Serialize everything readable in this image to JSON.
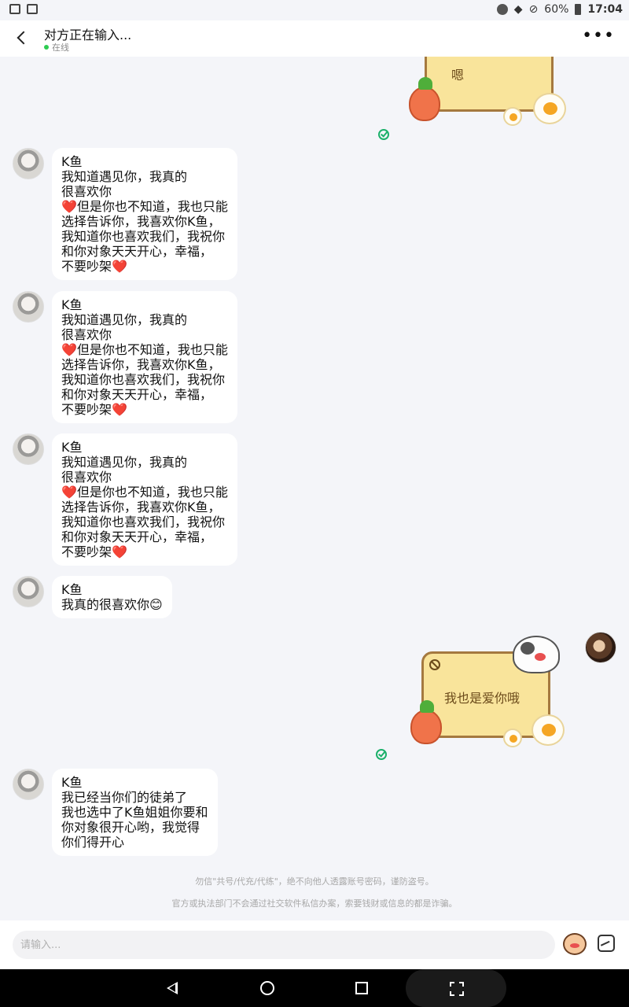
{
  "status_bar": {
    "battery": "60%",
    "time": "17:04"
  },
  "header": {
    "title": "对方正在输入...",
    "status": "在线"
  },
  "messages": [
    {
      "name": "K鱼",
      "lines": [
        "我知道遇见你，我真的",
        "很喜欢你",
        "❤️但是你也不知道，我也只能",
        "选择告诉你，我喜欢你K鱼，",
        "我知道你也喜欢我们，我祝你",
        "和你对象天天开心，幸福，",
        "不要吵架❤️"
      ]
    },
    {
      "name": "K鱼",
      "lines": [
        "我知道遇见你，我真的",
        "很喜欢你",
        "❤️但是你也不知道，我也只能",
        "选择告诉你，我喜欢你K鱼，",
        "我知道你也喜欢我们，我祝你",
        "和你对象天天开心，幸福，",
        "不要吵架❤️"
      ]
    },
    {
      "name": "K鱼",
      "lines": [
        "我知道遇见你，我真的",
        "很喜欢你",
        "❤️但是你也不知道，我也只能",
        "选择告诉你，我喜欢你K鱼，",
        "我知道你也喜欢我们，我祝你",
        "和你对象天天开心，幸福，",
        "不要吵架❤️"
      ]
    },
    {
      "name": "K鱼",
      "lines": [
        "我真的很喜欢你😊"
      ]
    },
    {
      "name": "K鱼",
      "lines": [
        "我已经当你们的徒弟了",
        "我也选中了K鱼姐姐你要和",
        "你对象很开心哟，我觉得",
        "你们得开心"
      ]
    }
  ],
  "stickers": {
    "top_text": "嗯",
    "mid_text": "我也是爱你哦"
  },
  "notices": [
    "勿信\"共号/代充/代练\"，绝不向他人透露账号密码，谨防盗号。",
    "官方或执法部门不会通过社交软件私信办案，索要钱财或信息的都是诈骗。"
  ],
  "input": {
    "placeholder": "请输入..."
  },
  "icons": {
    "back": "chevron-left-icon",
    "more": "more-dots-icon",
    "emoji": "emoji-sticker-icon",
    "image": "image-icon",
    "read": "check-circle-icon"
  },
  "colors": {
    "online": "#2ecc52",
    "read_check": "#1bb06a",
    "heart": "#d8232a",
    "sticker_card": "#f9e49b"
  }
}
